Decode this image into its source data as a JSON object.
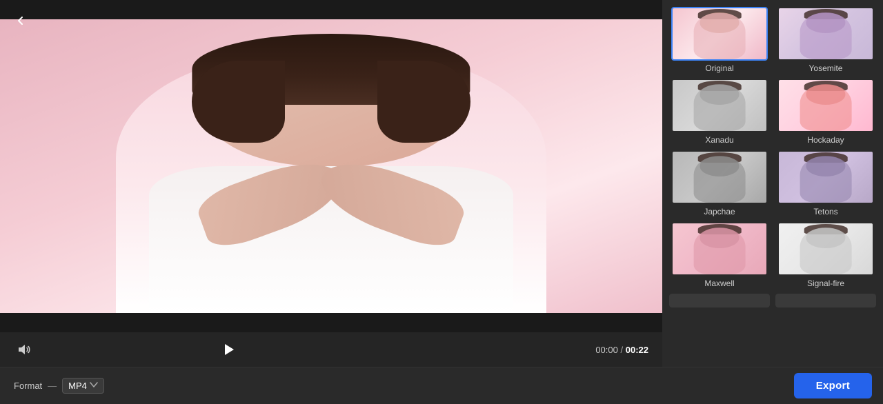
{
  "app": {
    "back_label": "‹"
  },
  "player": {
    "time_current": "00:00",
    "time_separator": " / ",
    "time_total": "00:22"
  },
  "format_bar": {
    "label": "Format",
    "dash": "—",
    "value": "MP4",
    "chevron": "⌄"
  },
  "export_btn": "Export",
  "filters": [
    {
      "id": "original",
      "label": "Original",
      "selected": true
    },
    {
      "id": "yosemite",
      "label": "Yosemite",
      "selected": false
    },
    {
      "id": "xanadu",
      "label": "Xanadu",
      "selected": false
    },
    {
      "id": "hockaday",
      "label": "Hockaday",
      "selected": false
    },
    {
      "id": "japchae",
      "label": "Japchae",
      "selected": false
    },
    {
      "id": "tetons",
      "label": "Tetons",
      "selected": false
    },
    {
      "id": "maxwell",
      "label": "Maxwell",
      "selected": false
    },
    {
      "id": "signal-fire",
      "label": "Signal-fire",
      "selected": false
    }
  ]
}
